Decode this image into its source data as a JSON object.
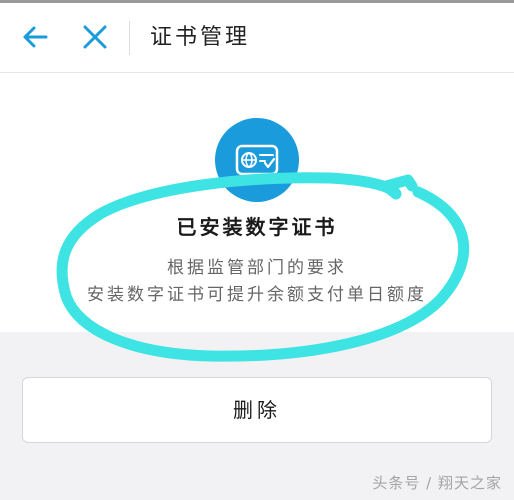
{
  "header": {
    "title": "证书管理",
    "back_icon": "arrow-left-icon",
    "close_icon": "close-icon",
    "accent_color": "#1a9bdc"
  },
  "certificate": {
    "icon": "digital-certificate-icon",
    "badge_color": "#1a9bdc",
    "status_title": "已安装数字证书",
    "description_line_1": "根据监管部门的要求",
    "description_line_2": "安装数字证书可提升余额支付单日额度"
  },
  "actions": {
    "delete_label": "删除"
  },
  "annotation": {
    "color": "#3ee3e3"
  },
  "watermark": {
    "text": "头条号 / 翔天之家"
  }
}
